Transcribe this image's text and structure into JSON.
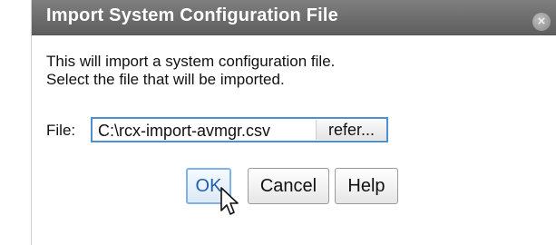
{
  "dialog": {
    "title": "Import System Configuration File",
    "close_icon": "close-icon",
    "message_line1": "This will import a system configuration file.",
    "message_line2": "Select the file that will be imported.",
    "file_label": "File:",
    "file_value": "C:\\rcx-import-avmgr.csv",
    "refer_label": "refer...",
    "ok_label": "OK",
    "cancel_label": "Cancel",
    "help_label": "Help"
  },
  "colors": {
    "titlebar": "#6e6e6e",
    "focus_border": "#4a8fd8",
    "ok_text": "#1f5fae"
  }
}
